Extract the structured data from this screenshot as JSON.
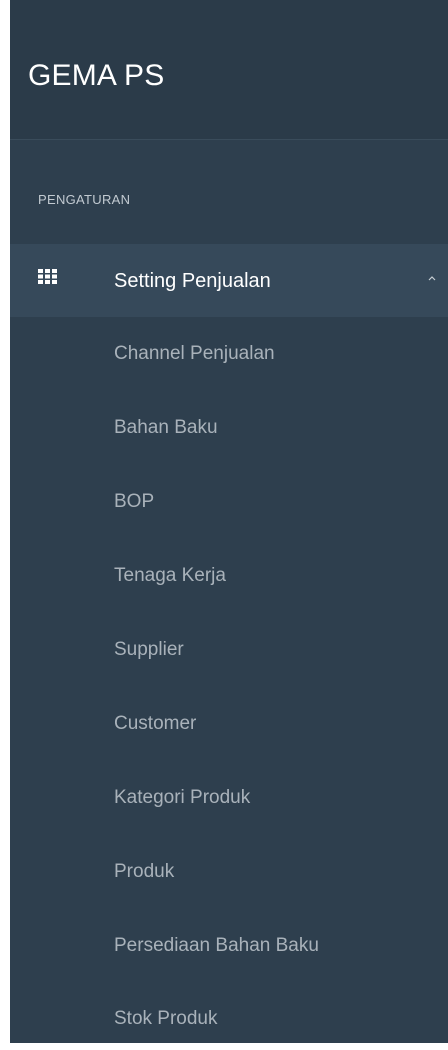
{
  "brand": {
    "title": "GEMA PS"
  },
  "sidebar": {
    "section_heading": "PENGATURAN",
    "active_menu": {
      "label": "Setting Penjualan",
      "icon": "grid-icon",
      "expanded": true
    },
    "submenu": [
      {
        "label": "Channel Penjualan"
      },
      {
        "label": "Bahan Baku"
      },
      {
        "label": "BOP"
      },
      {
        "label": "Tenaga Kerja"
      },
      {
        "label": "Supplier"
      },
      {
        "label": "Customer"
      },
      {
        "label": "Kategori Produk"
      },
      {
        "label": "Produk"
      },
      {
        "label": "Persediaan Bahan Baku"
      },
      {
        "label": "Stok Produk"
      }
    ]
  },
  "colors": {
    "sidebar_bg": "#2e3f4e",
    "brand_bg": "#2b3b49",
    "active_item_bg": "#36495a",
    "text_primary": "#ffffff",
    "text_muted": "#a9b2ba"
  }
}
